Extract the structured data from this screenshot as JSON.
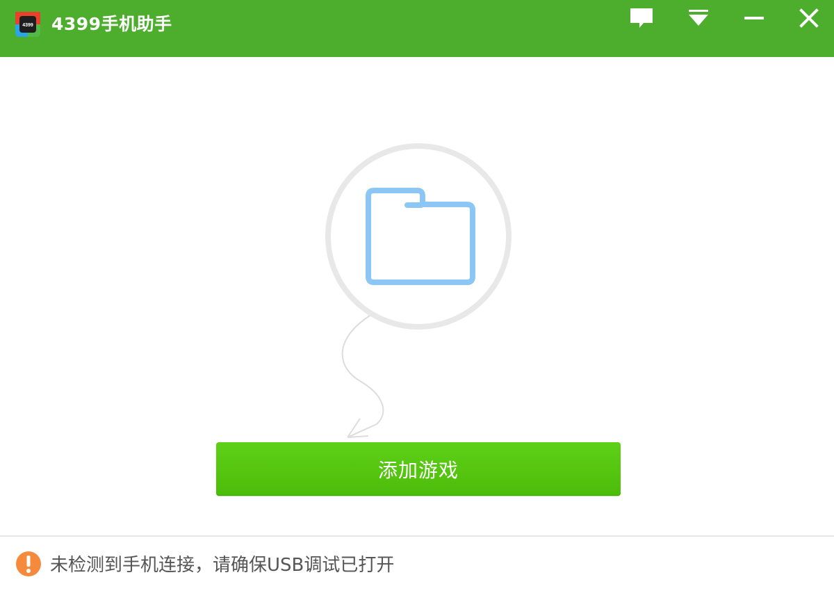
{
  "window": {
    "title": "4399手机助手",
    "logo_text": "4399",
    "accent_color": "#4cae2c",
    "controls": {
      "feedback": "feedback-icon",
      "menu": "menu-dropdown-icon",
      "minimize": "minimize-icon",
      "close": "close-icon"
    }
  },
  "main": {
    "illustration_icon": "folder-icon",
    "folder_color": "#8cc6f5",
    "add_game_button": {
      "label": "添加游戏",
      "color": "#54c510"
    }
  },
  "status_bar": {
    "icon": "warning-icon",
    "icon_color": "#f58a3c",
    "message": "未检测到手机连接，请确保USB调试已打开"
  }
}
